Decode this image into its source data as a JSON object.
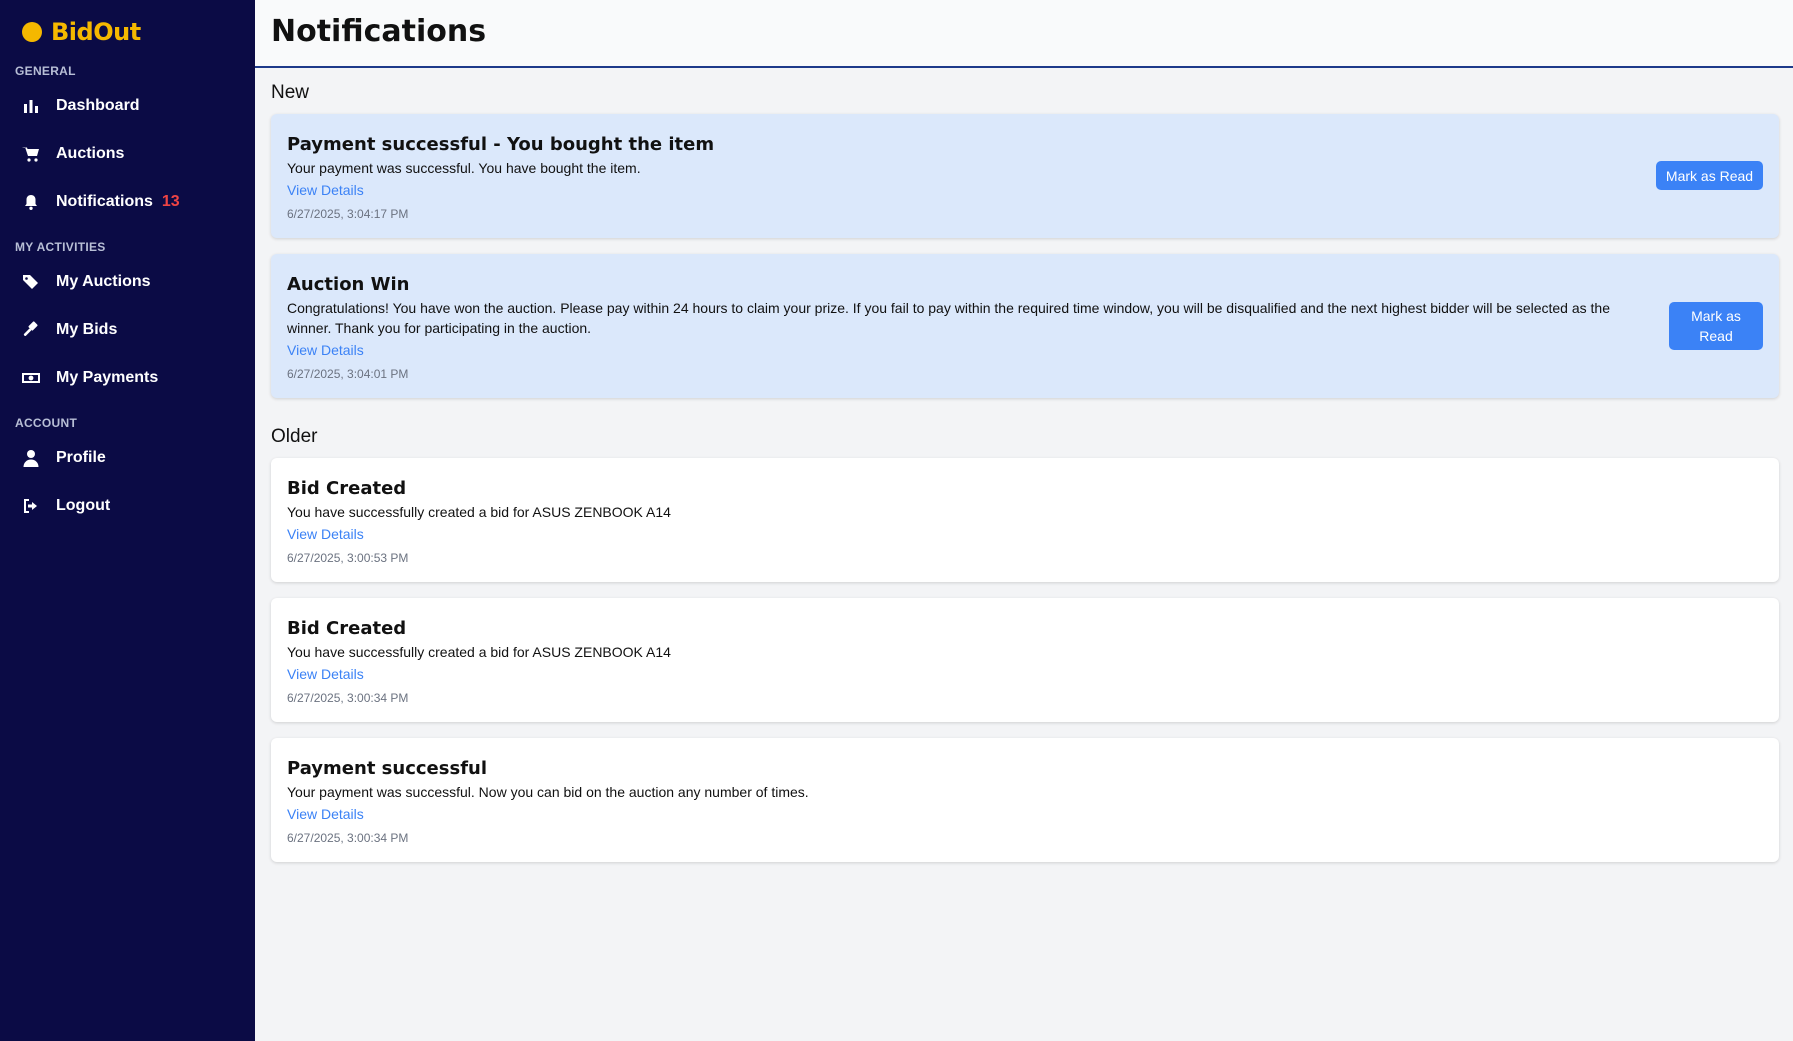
{
  "brand": {
    "part1": "Bid",
    "part2": "Out"
  },
  "sidebar": {
    "sections": [
      "GENERAL",
      "MY ACTIVITIES",
      "ACCOUNT"
    ],
    "items": [
      {
        "label": "Dashboard",
        "icon": "bar-chart-icon"
      },
      {
        "label": "Auctions",
        "icon": "cart-icon"
      },
      {
        "label": "Notifications",
        "icon": "bell-icon",
        "badge": "13"
      },
      {
        "label": "My Auctions",
        "icon": "tags-icon"
      },
      {
        "label": "My Bids",
        "icon": "gavel-icon"
      },
      {
        "label": "My Payments",
        "icon": "money-icon"
      },
      {
        "label": "Profile",
        "icon": "user-icon"
      },
      {
        "label": "Logout",
        "icon": "logout-icon"
      }
    ]
  },
  "header": {
    "title": "Notifications"
  },
  "groups": {
    "new": "New",
    "older": "Older"
  },
  "notifications": {
    "new": [
      {
        "title": "Payment successful - You bought the item",
        "message": "Your payment was successful. You have bought the item.",
        "link": "View Details",
        "time": "6/27/2025, 3:04:17 PM",
        "action": "Mark as Read"
      },
      {
        "title": "Auction Win",
        "message": "Congratulations! You have won the auction. Please pay within 24 hours to claim your prize. If you fail to pay within the required time window, you will be disqualified and the next highest bidder will be selected as the winner. Thank you for participating in the auction.",
        "link": "View Details",
        "time": "6/27/2025, 3:04:01 PM",
        "action": "Mark as Read"
      }
    ],
    "older": [
      {
        "title": "Bid Created",
        "message": "You have successfully created a bid for ASUS ZENBOOK A14",
        "link": "View Details",
        "time": "6/27/2025, 3:00:53 PM"
      },
      {
        "title": "Bid Created",
        "message": "You have successfully created a bid for ASUS ZENBOOK A14",
        "link": "View Details",
        "time": "6/27/2025, 3:00:34 PM"
      },
      {
        "title": "Payment successful",
        "message": "Your payment was successful. Now you can bid on the auction any number of times.",
        "link": "View Details",
        "time": "6/27/2025, 3:00:34 PM"
      }
    ]
  },
  "colors": {
    "sidebar_bg": "#0b0b45",
    "brand_accent": "#f5b800",
    "badge": "#ef4444",
    "new_card_bg": "#dbe8fb",
    "button": "#3b82f6",
    "header_border": "#1e3a8a"
  }
}
